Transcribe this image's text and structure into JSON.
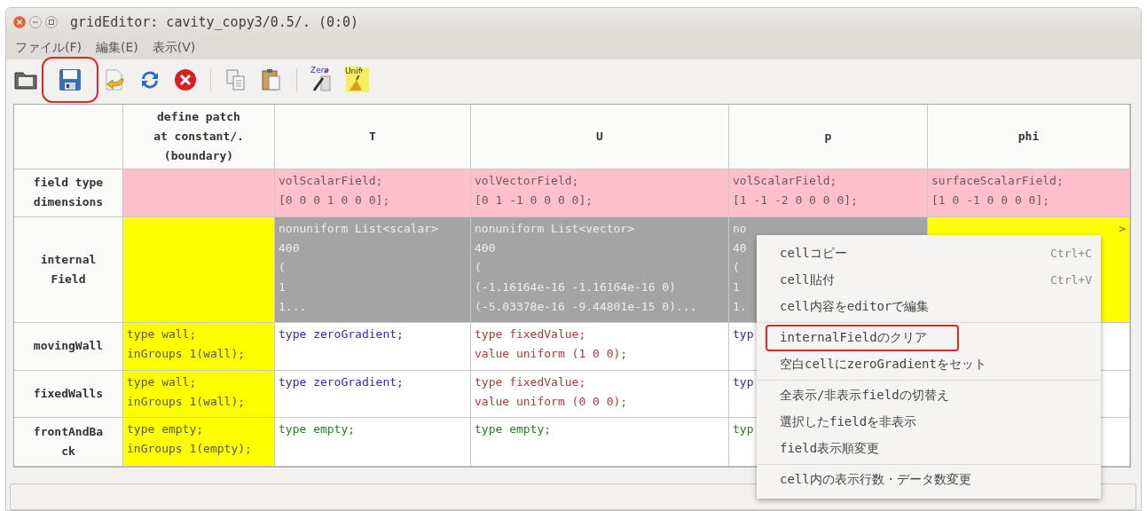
{
  "window": {
    "title": "gridEditor: cavity_copy3/0.5/. (0:0)"
  },
  "menu_bar": [
    "ファイル(F)",
    "編集(E)",
    "表示(V)"
  ],
  "toolbar": [
    {
      "kind": "folder",
      "highlighted": false
    },
    {
      "kind": "save",
      "highlighted": true
    },
    {
      "kind": "import",
      "highlighted": false
    },
    {
      "kind": "reload",
      "highlighted": false
    },
    {
      "kind": "close",
      "highlighted": false
    },
    {
      "kind": "separator"
    },
    {
      "kind": "copy",
      "highlighted": false
    },
    {
      "kind": "paste",
      "highlighted": false
    },
    {
      "kind": "separator"
    },
    {
      "kind": "zero",
      "label": "Zero",
      "highlighted": false
    },
    {
      "kind": "unif",
      "label": "Unif",
      "highlighted": false
    }
  ],
  "table": {
    "columns": [
      "define patch\nat constant/.\n(boundary)",
      "T",
      "U",
      "p",
      "phi"
    ],
    "rows": [
      {
        "header": "field type\ndimensions",
        "cells": [
          {
            "kind": "fieldtype",
            "text": ""
          },
          {
            "kind": "fieldtype",
            "text": "volScalarField;\n[0 0 0 1 0 0 0];"
          },
          {
            "kind": "fieldtype",
            "text": "volVectorField;\n[0 1 -1 0 0 0 0];"
          },
          {
            "kind": "fieldtype",
            "text": "volScalarField;\n[1 -1 -2 0 0 0 0];"
          },
          {
            "kind": "fieldtype",
            "text": "surfaceScalarField;\n[1 0 -1 0 0 0 0];"
          }
        ]
      },
      {
        "header": "internal\nField",
        "cells": [
          {
            "kind": "boundary",
            "text": ""
          },
          {
            "kind": "internal",
            "text": "nonuniform List<scalar>\n400\n(\n1\n1..."
          },
          {
            "kind": "internal",
            "text": "nonuniform List<vector>\n400\n(\n(-1.16164e-16 -1.16164e-16 0)\n(-5.03378e-16 -9.44801e-15 0)..."
          },
          {
            "kind": "internal",
            "text": "no\n40\n(\n1\n1."
          },
          {
            "kind": "uniform",
            "text": ">"
          }
        ]
      },
      {
        "header": "movingWall",
        "cells": [
          {
            "kind": "boundary",
            "text": "type wall;\ninGroups 1(wall);"
          },
          {
            "kind": "patch",
            "color": "#2b2bb8",
            "text": "type zeroGradient;"
          },
          {
            "kind": "patch",
            "color": "#a53a3a",
            "text": "type fixedValue;\nvalue uniform (1 0 0);"
          },
          {
            "kind": "patch",
            "color": "#2b2bb8",
            "text": "typ"
          },
          {
            "kind": "patch",
            "text": ""
          }
        ]
      },
      {
        "header": "fixedWalls",
        "cells": [
          {
            "kind": "boundary",
            "text": "type wall;\ninGroups 1(wall);"
          },
          {
            "kind": "patch",
            "color": "#2b2bb8",
            "text": "type zeroGradient;"
          },
          {
            "kind": "patch",
            "color": "#a53a3a",
            "text": "type fixedValue;\nvalue uniform (0 0 0);"
          },
          {
            "kind": "patch",
            "color": "#2b2bb8",
            "text": "typ"
          },
          {
            "kind": "patch",
            "text": ""
          }
        ]
      },
      {
        "header": "frontAndBa\nck",
        "cells": [
          {
            "kind": "boundary",
            "text": "type empty;\ninGroups 1(empty);"
          },
          {
            "kind": "patch",
            "color": "#2a7a2a",
            "text": "type empty;"
          },
          {
            "kind": "patch",
            "color": "#2a7a2a",
            "text": "type empty;"
          },
          {
            "kind": "patch",
            "color": "#2a7a2a",
            "text": "typ"
          },
          {
            "kind": "patch",
            "text": ""
          }
        ]
      }
    ]
  },
  "context_menu": {
    "groups": [
      [
        {
          "label": "cellコピー",
          "shortcut": "Ctrl+C",
          "highlighted": false
        },
        {
          "label": "cell貼付",
          "shortcut": "Ctrl+V",
          "highlighted": false
        },
        {
          "label": "cell内容をeditorで編集",
          "highlighted": false
        }
      ],
      [
        {
          "label": "internalFieldのクリア",
          "highlighted": true
        },
        {
          "label": "空白cellにzeroGradientをセット",
          "highlighted": false
        }
      ],
      [
        {
          "label": "全表示/非表示fieldの切替え",
          "highlighted": false
        },
        {
          "label": "選択したfieldを非表示",
          "highlighted": false
        },
        {
          "label": "field表示順変更",
          "highlighted": false
        }
      ],
      [
        {
          "label": "cell内の表示行数・データ数変更",
          "highlighted": false
        }
      ]
    ]
  }
}
